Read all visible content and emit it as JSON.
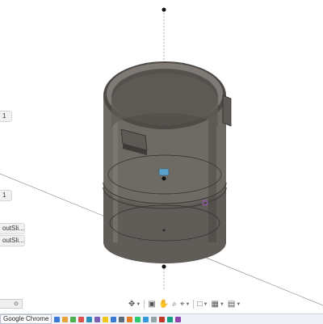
{
  "left_tags": {
    "tag1": "1",
    "tag2": "1",
    "tag3": "outSli...",
    "tag4": "outSli..."
  },
  "bottom_left_box": "⊙",
  "nav_toolbar": [
    {
      "name": "orbit-icon",
      "glyph": "✥"
    },
    {
      "name": "look-at-icon",
      "glyph": "▣"
    },
    {
      "name": "pan-icon",
      "glyph": "✋"
    },
    {
      "name": "zoom-icon",
      "glyph": "⌕"
    },
    {
      "name": "fit-icon",
      "glyph": "⌖"
    },
    {
      "name": "display-settings-icon",
      "glyph": "□"
    },
    {
      "name": "grid-settings-icon",
      "glyph": "▦"
    },
    {
      "name": "viewports-icon",
      "glyph": "▤"
    }
  ],
  "taskbar": {
    "app_label": "Google Chrome"
  },
  "colors": {
    "body": "#6e6a64",
    "body_dark": "#4e4b47",
    "highlight": "#a8a39c",
    "selection": "#9b59b6",
    "axis_dot": "#111111"
  }
}
